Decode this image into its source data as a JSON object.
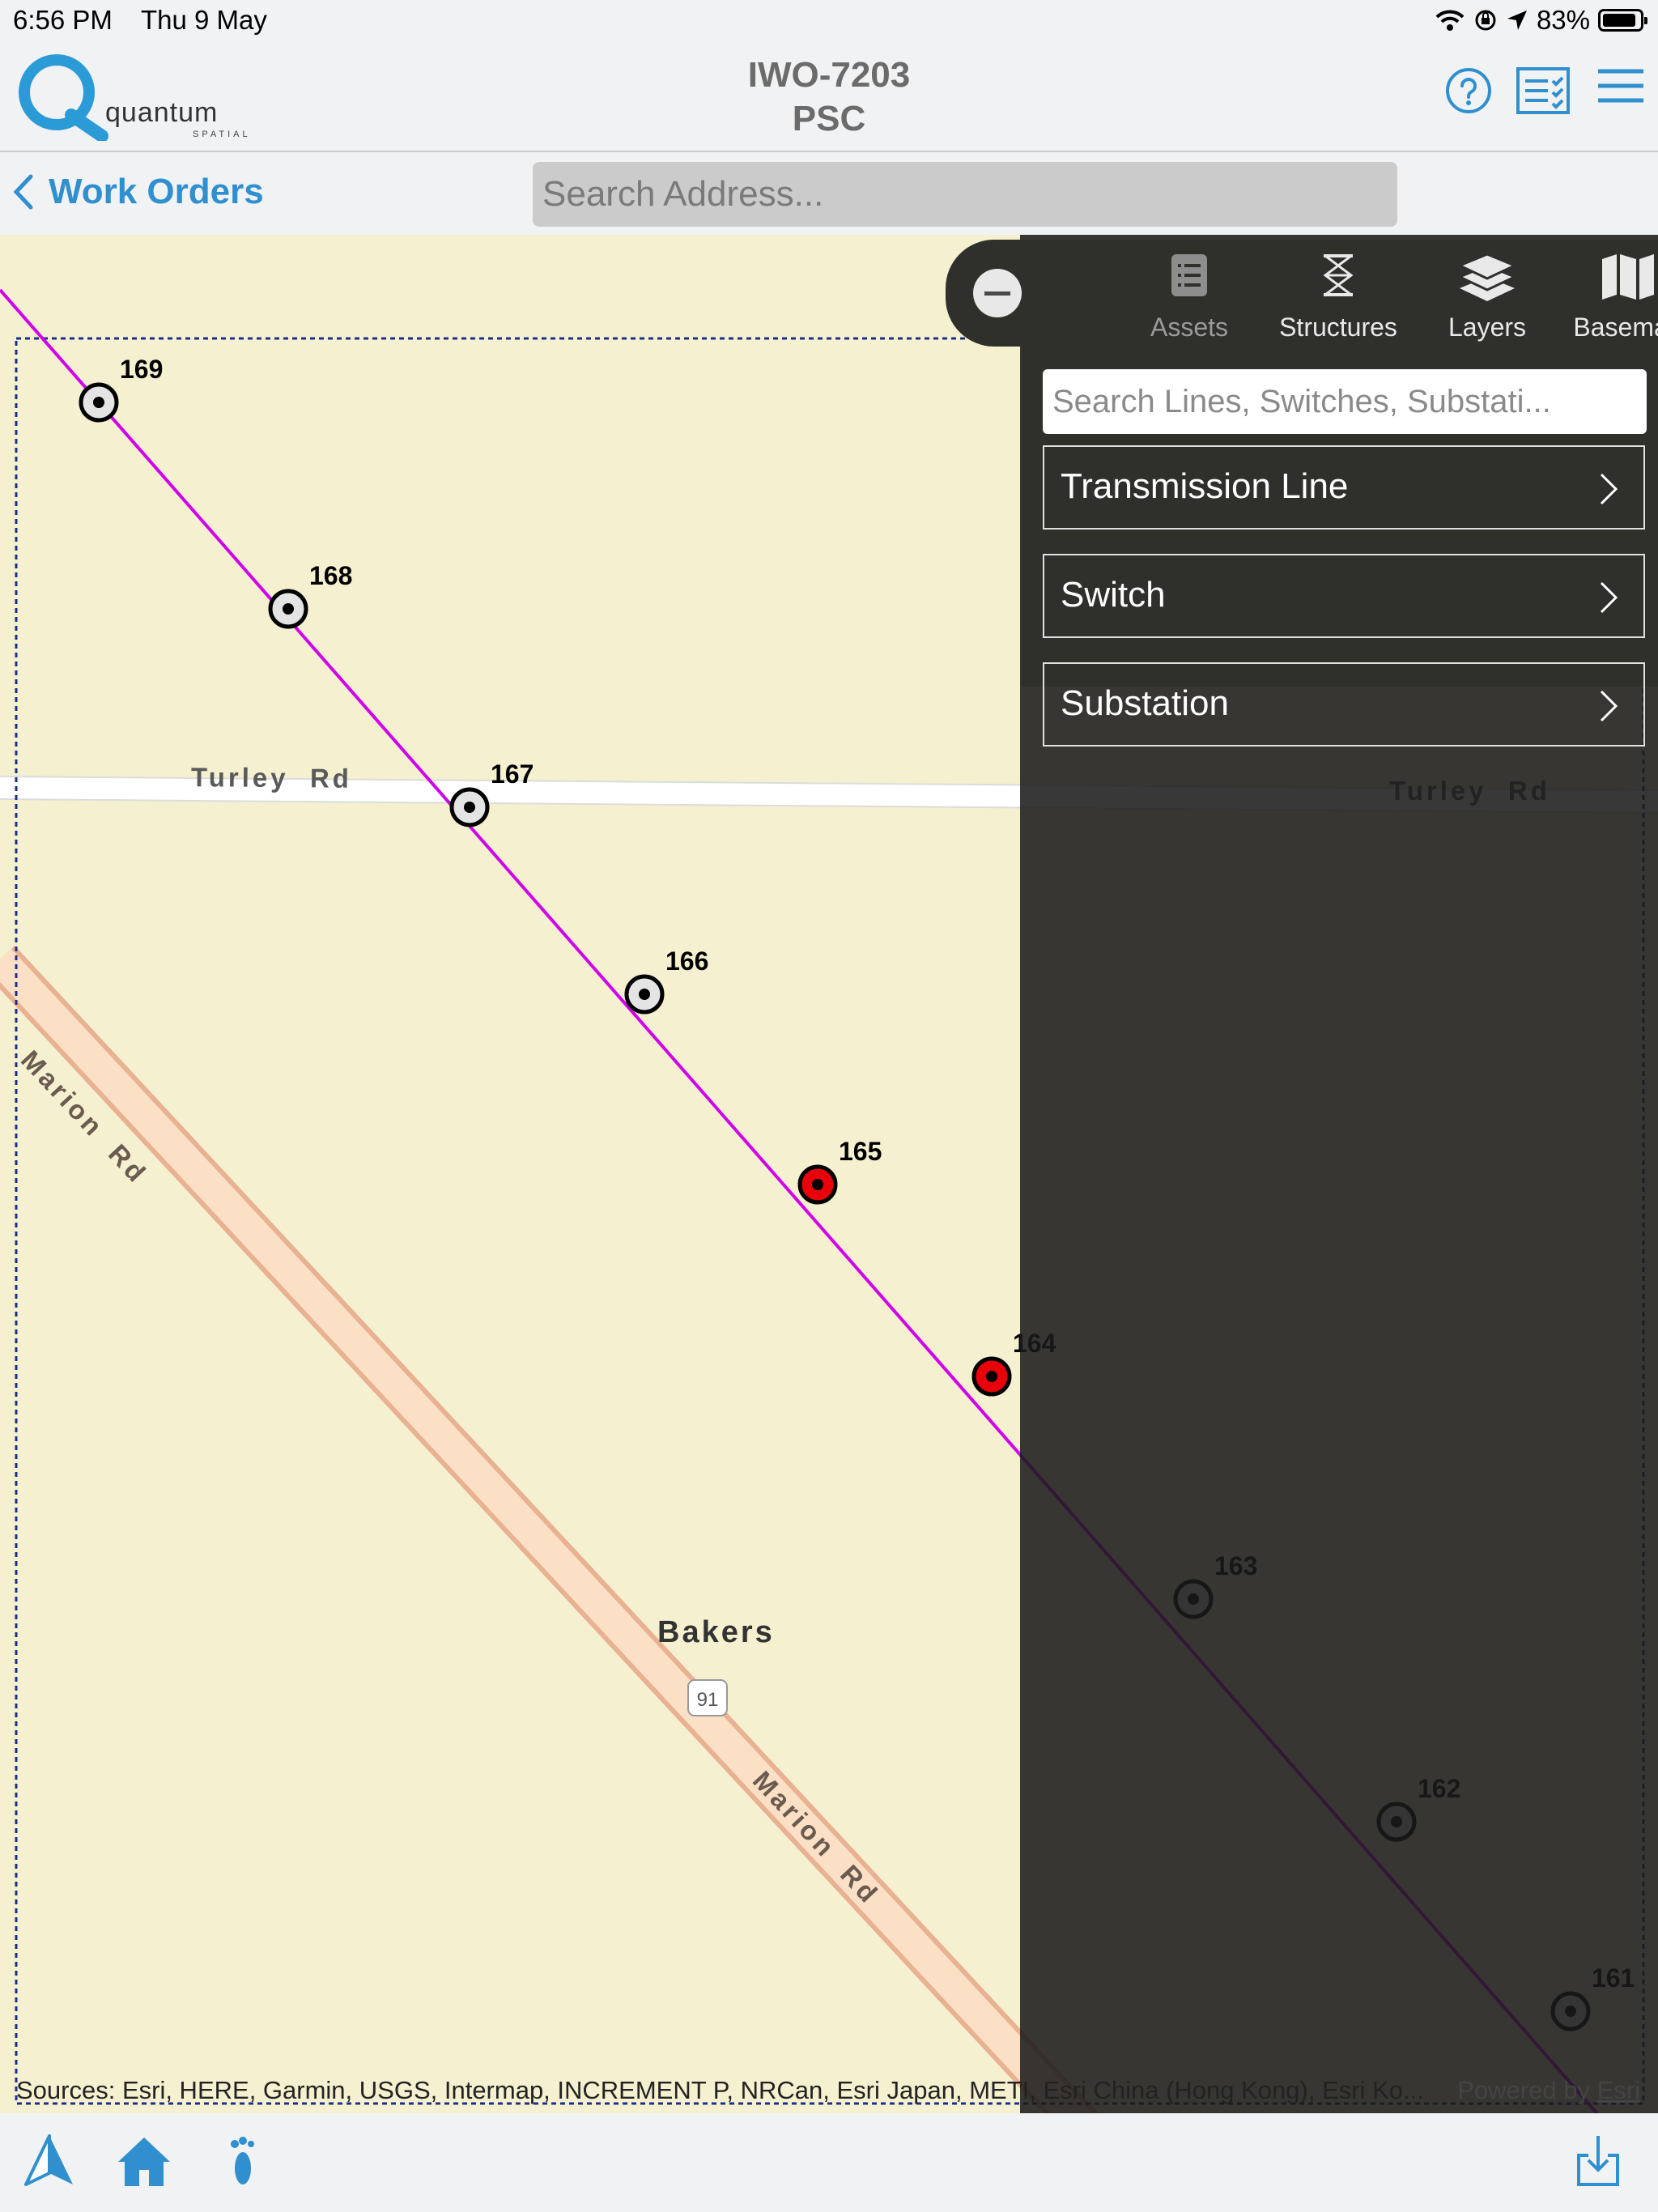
{
  "status_bar": {
    "time": "6:56 PM",
    "date": "Thu 9 May",
    "battery": "83%"
  },
  "logo": {
    "word": "quantum",
    "sub": "SPATIAL"
  },
  "header": {
    "title_line1": "IWO-7203",
    "title_line2": "PSC"
  },
  "nav": {
    "back_label": "Work Orders",
    "address_placeholder": "Search Address..."
  },
  "toolbar": {
    "assets": "Assets",
    "structures": "Structures",
    "layers": "Layers",
    "basemap": "Basemap"
  },
  "panel": {
    "search_placeholder": "Search Lines, Switches, Substati...",
    "items": [
      {
        "label": "Transmission Line"
      },
      {
        "label": "Switch"
      },
      {
        "label": "Substation"
      }
    ]
  },
  "map": {
    "road_turley": "Turley  Rd",
    "road_marion": "Marion  Rd",
    "place": "Bakers",
    "route_shield": "91",
    "structures": [
      "169",
      "168",
      "167",
      "166",
      "165",
      "164",
      "163",
      "162",
      "161"
    ],
    "attribution": "Sources: Esri, HERE, Garmin, USGS, Intermap, INCREMENT P, NRCan, Esri Japan, METI, Esri China (Hong Kong), Esri Ko...",
    "powered_by": "Powered by",
    "powered_link": "Esri"
  },
  "colors": {
    "accent": "#2f8fcf",
    "line": "#d000ea",
    "selected": "#e8000b",
    "panel": "#2f2f2c"
  }
}
